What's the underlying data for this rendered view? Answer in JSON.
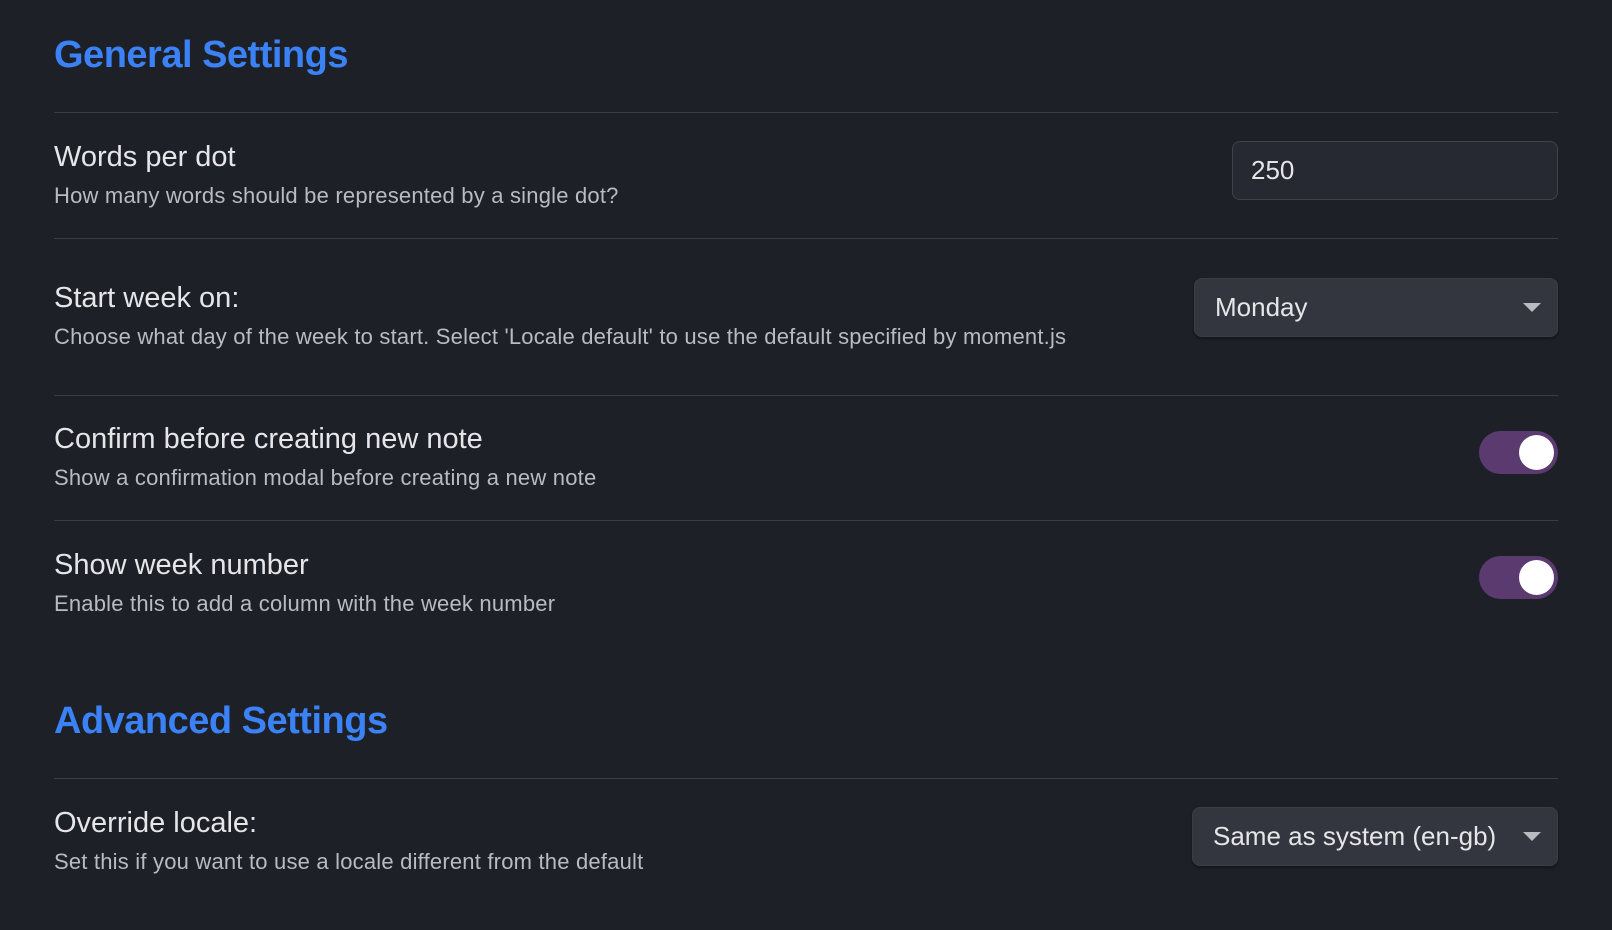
{
  "sections": {
    "general": {
      "title": "General Settings",
      "settings": {
        "words_per_dot": {
          "name": "Words per dot",
          "description": "How many words should be represented by a single dot?",
          "value": "250"
        },
        "start_week_on": {
          "name": "Start week on:",
          "description": "Choose what day of the week to start. Select 'Locale default' to use the default specified by moment.js",
          "selected": "Monday"
        },
        "confirm_new_note": {
          "name": "Confirm before creating new note",
          "description": "Show a confirmation modal before creating a new note",
          "enabled": true
        },
        "show_week_number": {
          "name": "Show week number",
          "description": "Enable this to add a column with the week number",
          "enabled": true
        }
      }
    },
    "advanced": {
      "title": "Advanced Settings",
      "settings": {
        "override_locale": {
          "name": "Override locale:",
          "description": "Set this if you want to use a locale different from the default",
          "selected": "Same as system (en-gb)"
        }
      }
    }
  },
  "colors": {
    "background": "#1e2028",
    "heading": "#3b82f6",
    "toggle_on": "#5b3a70",
    "divider": "#3a3d45"
  },
  "icons": {
    "dropdown": "chevron-down-icon"
  }
}
